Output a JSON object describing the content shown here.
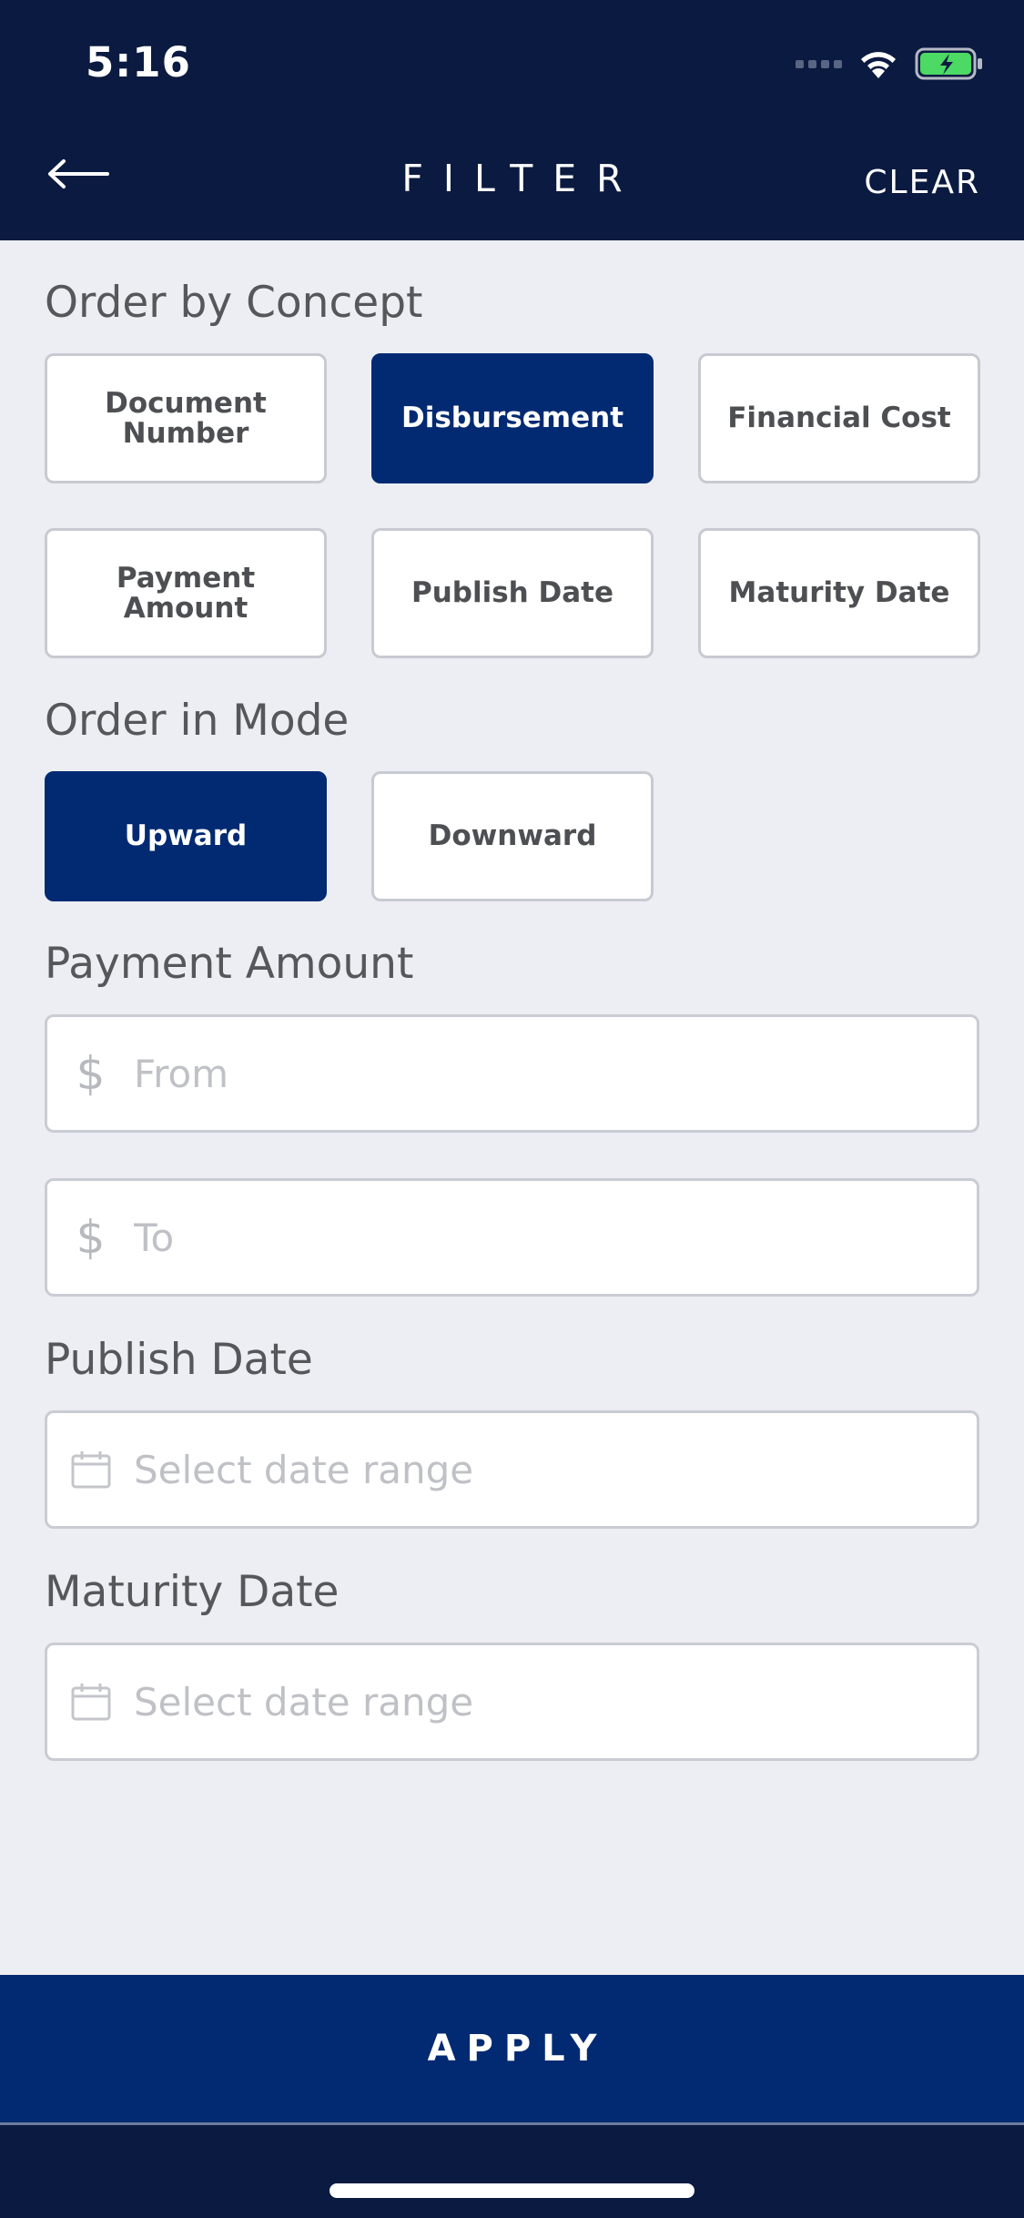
{
  "status_bar": {
    "time": "5:16",
    "icons": [
      "signal-icon",
      "wifi-icon",
      "battery-charging-icon"
    ]
  },
  "nav": {
    "back_icon": "arrow-left-icon",
    "title": "FILTER",
    "clear_label": "CLEAR"
  },
  "order_by_concept": {
    "title": "Order by Concept",
    "options": [
      {
        "label": "Document Number",
        "selected": false
      },
      {
        "label": "Disbursement",
        "selected": true
      },
      {
        "label": "Financial Cost",
        "selected": false
      },
      {
        "label": "Payment Amount",
        "selected": false
      },
      {
        "label": "Publish Date",
        "selected": false
      },
      {
        "label": "Maturity Date",
        "selected": false
      }
    ]
  },
  "order_in_mode": {
    "title": "Order in Mode",
    "options": [
      {
        "label": "Upward",
        "selected": true
      },
      {
        "label": "Downward",
        "selected": false
      }
    ]
  },
  "payment_amount": {
    "title": "Payment Amount",
    "currency_symbol": "$",
    "from_placeholder": "From",
    "to_placeholder": "To"
  },
  "publish_date": {
    "title": "Publish Date",
    "placeholder": "Select date range",
    "icon": "calendar-icon"
  },
  "maturity_date": {
    "title": "Maturity Date",
    "placeholder": "Select date range",
    "icon": "calendar-icon"
  },
  "apply_label": "APPLY",
  "colors": {
    "header_bg": "#0b1a40",
    "primary": "#012a72",
    "background": "#eceef3"
  }
}
